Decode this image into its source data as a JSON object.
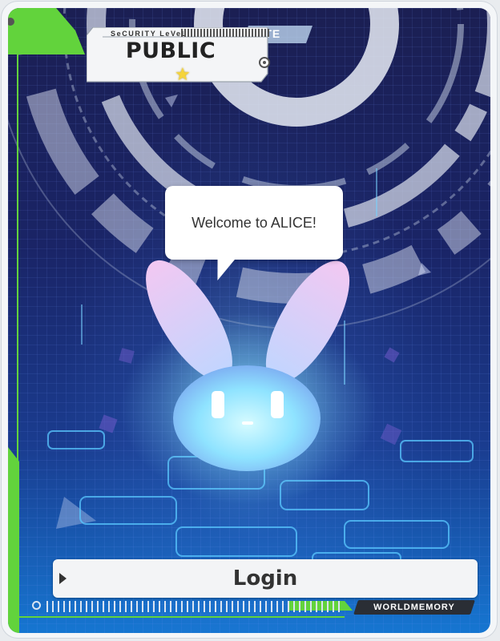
{
  "header": {
    "security_label": "SeCURITY LeVeL",
    "security_value": "PUBLIC",
    "ribbon_text": "ETE"
  },
  "dialog": {
    "message": "Welcome to ALICE!"
  },
  "login": {
    "label": "Login"
  },
  "footer": {
    "brand": "WORLDMEMORY"
  },
  "icons": {
    "star": "star-icon",
    "mascot": "bunny-mascot",
    "play": "play-arrow-icon"
  },
  "colors": {
    "accent_green": "#62d33c",
    "background_top": "#1b1f53",
    "background_bottom": "#1676d1",
    "star": "#f5d43a"
  }
}
